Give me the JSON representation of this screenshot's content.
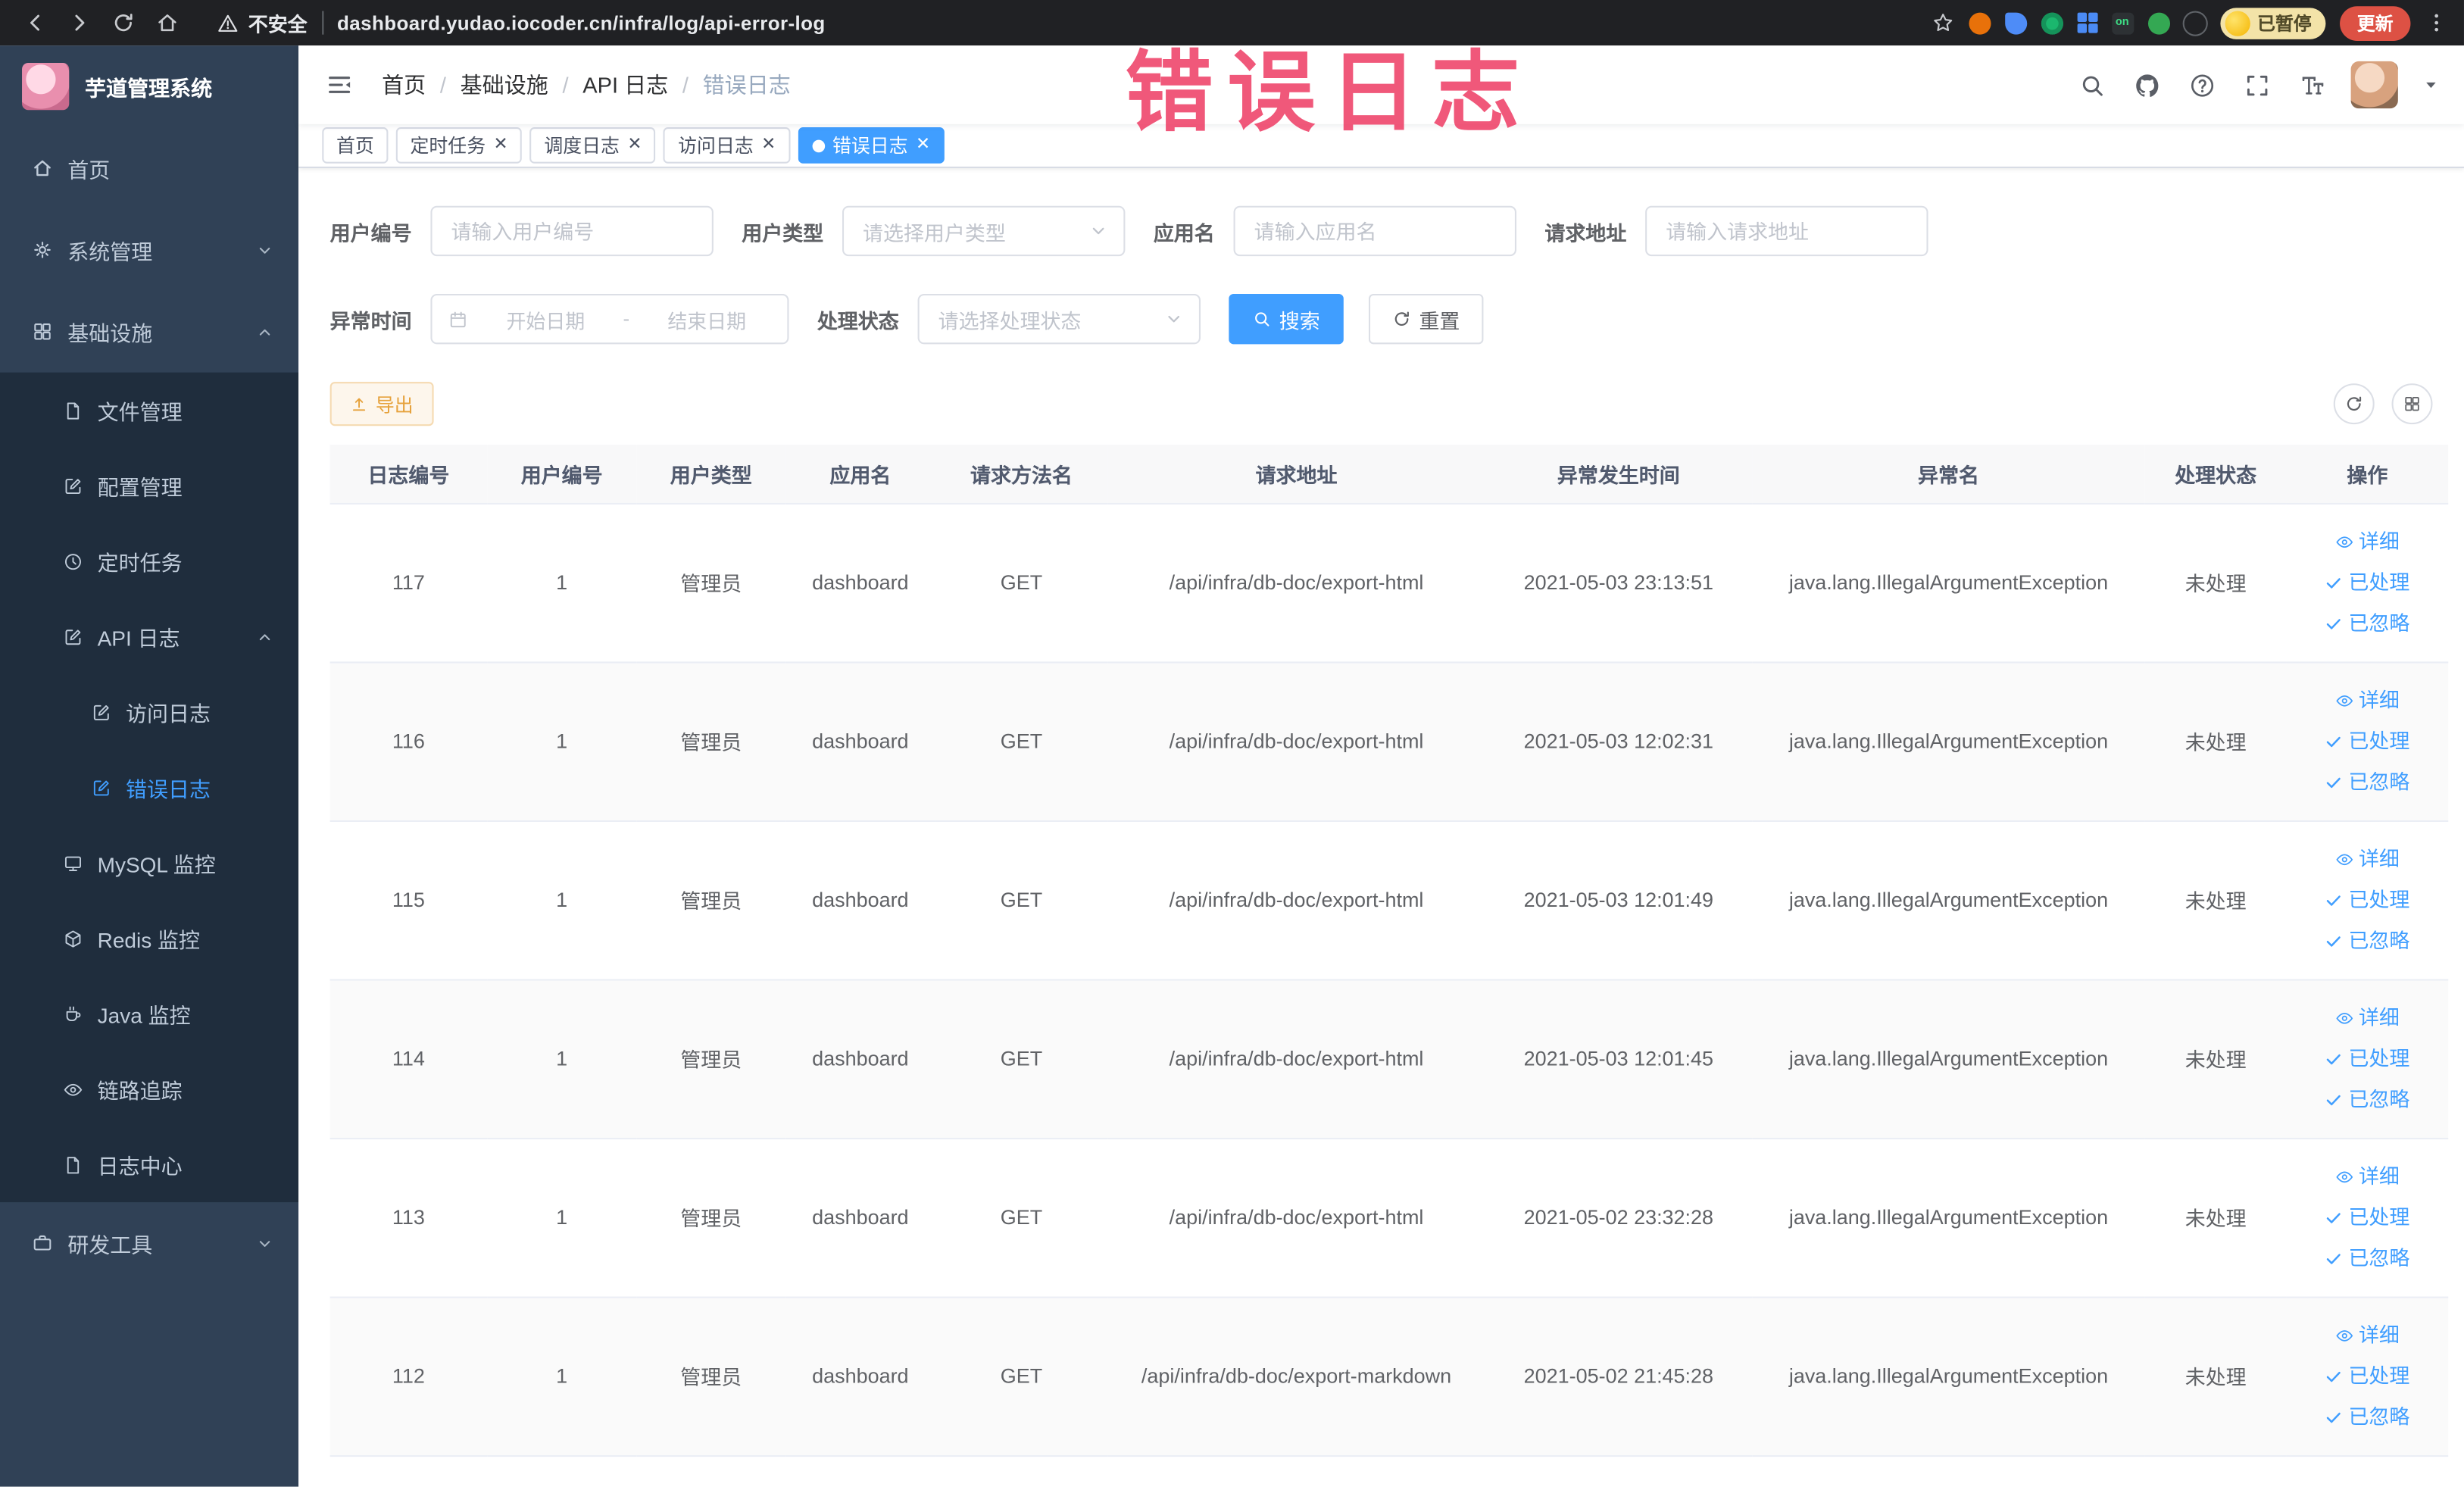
{
  "browser": {
    "security_label": "不安全",
    "url": "dashboard.yudao.iocoder.cn/infra/log/api-error-log",
    "paused_badge": "已暂停",
    "update_button": "更新"
  },
  "annotation": {
    "text": "错误日志"
  },
  "sidebar": {
    "logo_title": "芋道管理系统",
    "items": [
      {
        "label": "首页"
      },
      {
        "label": "系统管理"
      },
      {
        "label": "基础设施",
        "children": [
          {
            "label": "文件管理"
          },
          {
            "label": "配置管理"
          },
          {
            "label": "定时任务"
          },
          {
            "label": "API 日志",
            "children": [
              {
                "label": "访问日志"
              },
              {
                "label": "错误日志",
                "active": true
              }
            ]
          },
          {
            "label": "MySQL 监控"
          },
          {
            "label": "Redis 监控"
          },
          {
            "label": "Java 监控"
          },
          {
            "label": "链路追踪"
          },
          {
            "label": "日志中心"
          }
        ]
      },
      {
        "label": "研发工具"
      }
    ]
  },
  "topbar": {
    "breadcrumbs": [
      "首页",
      "基础设施",
      "API 日志",
      "错误日志"
    ]
  },
  "tabs": [
    {
      "label": "首页"
    },
    {
      "label": "定时任务"
    },
    {
      "label": "调度日志"
    },
    {
      "label": "访问日志"
    },
    {
      "label": "错误日志",
      "active": true
    }
  ],
  "filters": {
    "user_id_label": "用户编号",
    "user_id_placeholder": "请输入用户编号",
    "user_type_label": "用户类型",
    "user_type_placeholder": "请选择用户类型",
    "app_name_label": "应用名",
    "app_name_placeholder": "请输入应用名",
    "request_url_label": "请求地址",
    "request_url_placeholder": "请输入请求地址",
    "time_label": "异常时间",
    "time_start_placeholder": "开始日期",
    "time_separator": "-",
    "time_end_placeholder": "结束日期",
    "status_label": "处理状态",
    "status_placeholder": "请选择处理状态",
    "search_button": "搜索",
    "reset_button": "重置"
  },
  "toolbar": {
    "export_button": "导出"
  },
  "table": {
    "columns": [
      "日志编号",
      "用户编号",
      "用户类型",
      "应用名",
      "请求方法名",
      "请求地址",
      "异常发生时间",
      "异常名",
      "处理状态",
      "操作"
    ],
    "action_detail": "详细",
    "action_processed": "已处理",
    "action_ignored": "已忽略",
    "rows": [
      {
        "id": "117",
        "user_id": "1",
        "user_type": "管理员",
        "app": "dashboard",
        "method": "GET",
        "url": "/api/infra/db-doc/export-html",
        "time": "2021-05-03 23:13:51",
        "exception": "java.lang.IllegalArgumentException",
        "status": "未处理"
      },
      {
        "id": "116",
        "user_id": "1",
        "user_type": "管理员",
        "app": "dashboard",
        "method": "GET",
        "url": "/api/infra/db-doc/export-html",
        "time": "2021-05-03 12:02:31",
        "exception": "java.lang.IllegalArgumentException",
        "status": "未处理"
      },
      {
        "id": "115",
        "user_id": "1",
        "user_type": "管理员",
        "app": "dashboard",
        "method": "GET",
        "url": "/api/infra/db-doc/export-html",
        "time": "2021-05-03 12:01:49",
        "exception": "java.lang.IllegalArgumentException",
        "status": "未处理"
      },
      {
        "id": "114",
        "user_id": "1",
        "user_type": "管理员",
        "app": "dashboard",
        "method": "GET",
        "url": "/api/infra/db-doc/export-html",
        "time": "2021-05-03 12:01:45",
        "exception": "java.lang.IllegalArgumentException",
        "status": "未处理"
      },
      {
        "id": "113",
        "user_id": "1",
        "user_type": "管理员",
        "app": "dashboard",
        "method": "GET",
        "url": "/api/infra/db-doc/export-html",
        "time": "2021-05-02 23:32:28",
        "exception": "java.lang.IllegalArgumentException",
        "status": "未处理"
      },
      {
        "id": "112",
        "user_id": "1",
        "user_type": "管理员",
        "app": "dashboard",
        "method": "GET",
        "url": "/api/infra/db-doc/export-markdown",
        "time": "2021-05-02 21:45:28",
        "exception": "java.lang.IllegalArgumentException",
        "status": "未处理"
      }
    ]
  },
  "colors": {
    "accent": "#409eff",
    "warning": "#e6a23c",
    "annotation": "#ef4168",
    "sidebar": "#304156"
  }
}
